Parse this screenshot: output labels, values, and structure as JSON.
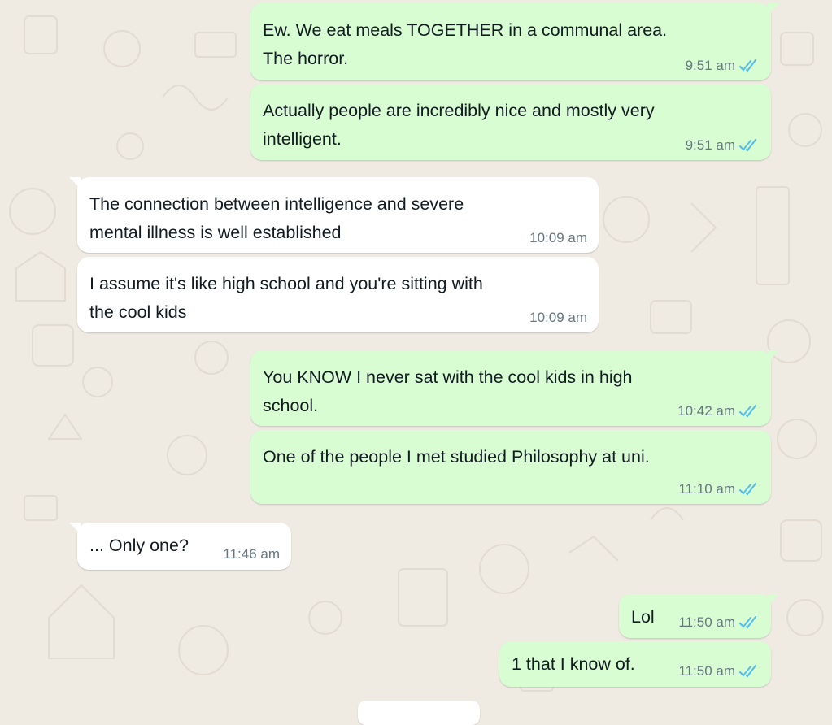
{
  "colors": {
    "outgoing_bubble": "#d9fdd3",
    "incoming_bubble": "#ffffff",
    "read_tick": "#53bdeb",
    "timestamp": "#667781",
    "wallpaper": "#efeae2"
  },
  "messages": [
    {
      "direction": "out",
      "text": "Ew. We eat meals TOGETHER in a communal area.\nThe horror.",
      "time": "9:51 am",
      "status_icon": "double-check-read-icon"
    },
    {
      "direction": "out",
      "text": "Actually people are incredibly nice and mostly very\nintelligent.",
      "time": "9:51 am",
      "status_icon": "double-check-read-icon"
    },
    {
      "direction": "in",
      "text": "The connection between intelligence and severe\nmental illness is well established",
      "time": "10:09 am"
    },
    {
      "direction": "in",
      "text": "I assume it's like high school and you're sitting with\nthe cool kids",
      "time": "10:09 am"
    },
    {
      "direction": "out",
      "text": "You KNOW I never sat with the cool kids in high\nschool.",
      "time": "10:42 am",
      "status_icon": "double-check-read-icon"
    },
    {
      "direction": "out",
      "text": "One of the people I met studied Philosophy at uni.",
      "time": "11:10 am",
      "status_icon": "double-check-read-icon"
    },
    {
      "direction": "in",
      "text": "... Only one?",
      "time": "11:46 am"
    },
    {
      "direction": "out",
      "text": "Lol",
      "time": "11:50 am",
      "status_icon": "double-check-read-icon"
    },
    {
      "direction": "out",
      "text": "1 that I know of.",
      "time": "11:50 am",
      "status_icon": "double-check-read-icon"
    }
  ]
}
